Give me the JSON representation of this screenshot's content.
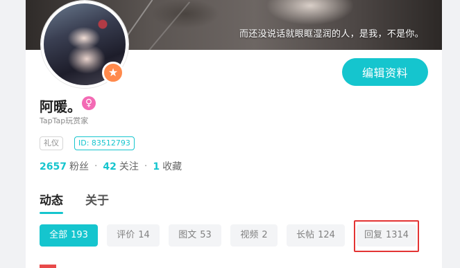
{
  "banner": {
    "quote": "而还没说话就眼眶湿润的人，是我，不是你。"
  },
  "profile": {
    "name": "阿暖。",
    "gender_symbol": "♀",
    "badge_symbol": "★",
    "subtitle": "TapTap玩赏家",
    "tags": {
      "etiquette": "礼仪",
      "id": "ID: 83512793"
    },
    "edit_button": "编辑资料"
  },
  "stats": {
    "fans_count": "2657",
    "fans_label": "粉丝",
    "following_count": "42",
    "following_label": "关注",
    "favorites_count": "1",
    "favorites_label": "收藏",
    "separator": "·"
  },
  "tabs": {
    "activity": "动态",
    "about": "关于"
  },
  "filters": {
    "all": {
      "label": "全部",
      "count": "193"
    },
    "review": {
      "label": "评价",
      "count": "14"
    },
    "image_text": {
      "label": "图文",
      "count": "53"
    },
    "video": {
      "label": "视频",
      "count": "2"
    },
    "long_post": {
      "label": "长帖",
      "count": "124"
    },
    "reply": {
      "label": "回复",
      "count": "1314"
    }
  },
  "colors": {
    "accent": "#15c5ce",
    "badge": "#ff8a4c",
    "gender": "#f36ab4",
    "highlight": "#e33333"
  }
}
